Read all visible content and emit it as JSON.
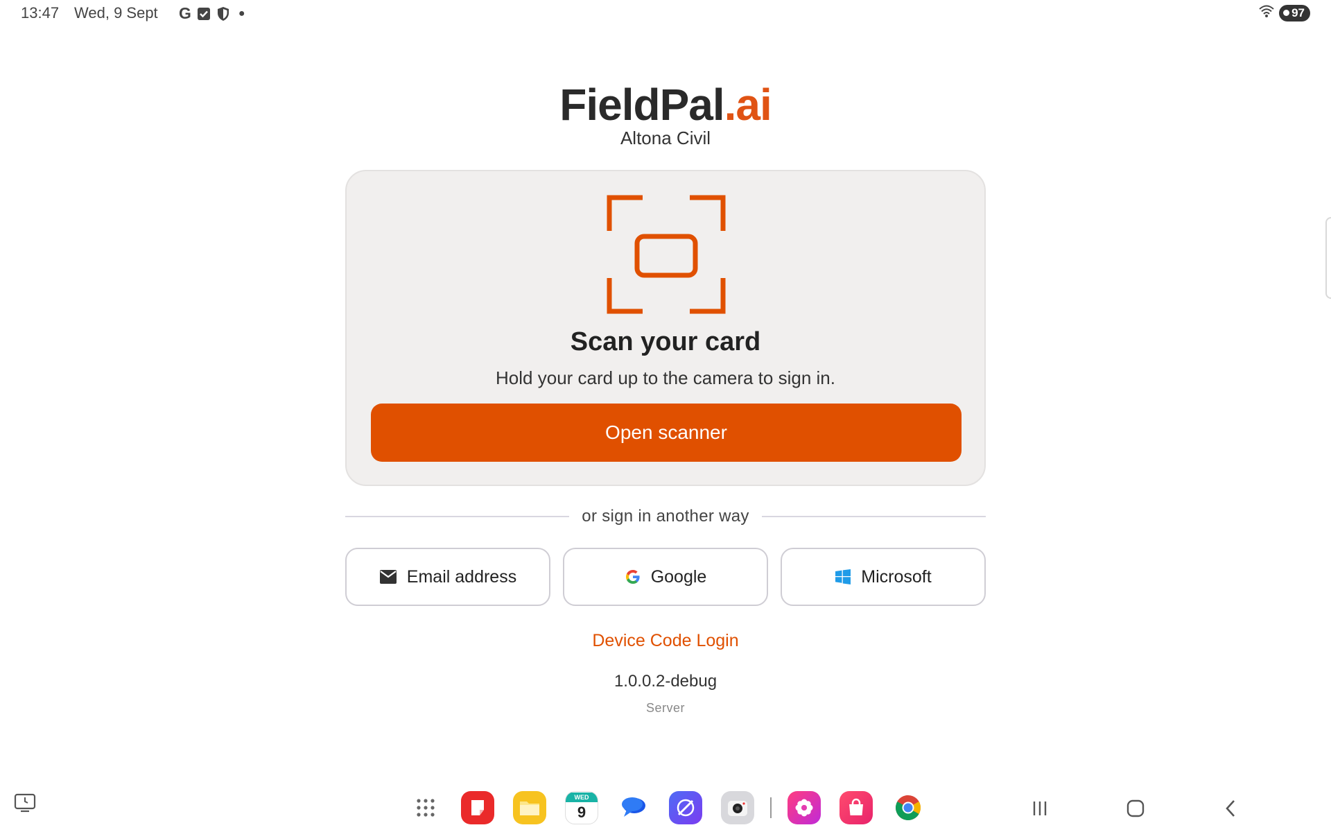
{
  "status_bar": {
    "time": "13:47",
    "date": "Wed, 9 Sept",
    "battery": "97",
    "icons": [
      "google-icon",
      "checkbox-icon",
      "shield-icon",
      "dot-icon",
      "wifi-icon",
      "battery-icon"
    ]
  },
  "header": {
    "brand_main": "FieldPal",
    "brand_accent": ".ai",
    "organization": "Altona Civil"
  },
  "scan_card": {
    "title": "Scan your card",
    "subtitle": "Hold your card up to the camera to sign in.",
    "button_label": "Open scanner",
    "icon": "scan-frame-icon"
  },
  "divider": {
    "text": "or sign in another way"
  },
  "alt_signin": {
    "email_label": "Email address",
    "google_label": "Google",
    "microsoft_label": "Microsoft"
  },
  "footer": {
    "device_code_label": "Device Code Login",
    "version": "1.0.0.2-debug",
    "server_label": "Server"
  },
  "taskbar": {
    "calendar_day": "9",
    "calendar_weekday": "WED",
    "apps": [
      "app-drawer-icon",
      "notes-app-icon",
      "files-app-icon",
      "calendar-app-icon",
      "messages-app-icon",
      "browser-app-icon",
      "camera-app-icon",
      "gallery-app-icon",
      "store-app-icon",
      "chrome-app-icon"
    ],
    "nav": [
      "recents-icon",
      "home-icon",
      "back-icon"
    ]
  },
  "colors": {
    "accent": "#e05000",
    "brand_accent": "#e05314",
    "card_bg": "#f1efee",
    "microsoft_blue": "#1f9be8"
  }
}
